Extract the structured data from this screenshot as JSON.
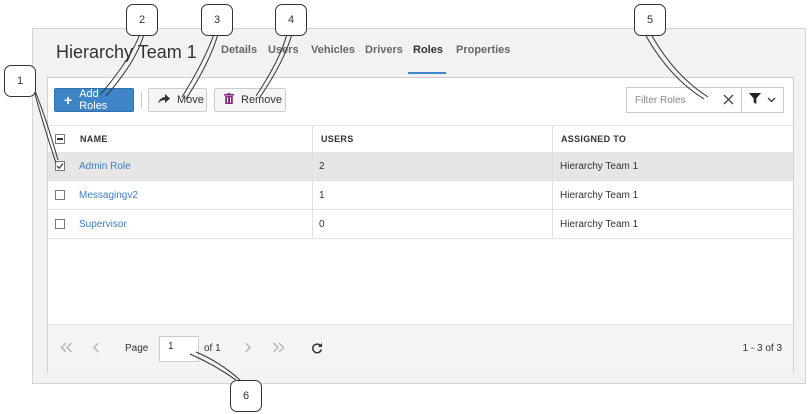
{
  "page_title": "Hierarchy Team 1",
  "tabs": [
    "Details",
    "Users",
    "Vehicles",
    "Drivers",
    "Roles",
    "Properties"
  ],
  "active_tab": "Roles",
  "toolbar": {
    "add_label": "Add Roles",
    "move_label": "Move",
    "remove_label": "Remove"
  },
  "filter": {
    "placeholder": "Filter Roles"
  },
  "table": {
    "headers": [
      "NAME",
      "USERS",
      "ASSIGNED TO"
    ],
    "rows": [
      {
        "name": "Admin Role",
        "users": "2",
        "assigned_to": "Hierarchy Team 1",
        "checked": true
      },
      {
        "name": "Messagingv2",
        "users": "1",
        "assigned_to": "Hierarchy Team 1",
        "checked": false
      },
      {
        "name": "Supervisor",
        "users": "0",
        "assigned_to": "Hierarchy Team 1",
        "checked": false
      }
    ]
  },
  "pager": {
    "page_label": "Page",
    "page_value": "1",
    "of_label": "of 1",
    "range_label": "1 - 3 of 3"
  },
  "callouts": [
    "1",
    "2",
    "3",
    "4",
    "5",
    "6"
  ],
  "colors": {
    "accent": "#3d85c6",
    "link": "#3d7fc0"
  },
  "icons": [
    "plus-icon",
    "share-arrow-icon",
    "trash-icon",
    "clear-icon",
    "funnel-icon",
    "chevron-down-icon",
    "first-page-icon",
    "prev-page-icon",
    "next-page-icon",
    "last-page-icon",
    "refresh-icon"
  ]
}
